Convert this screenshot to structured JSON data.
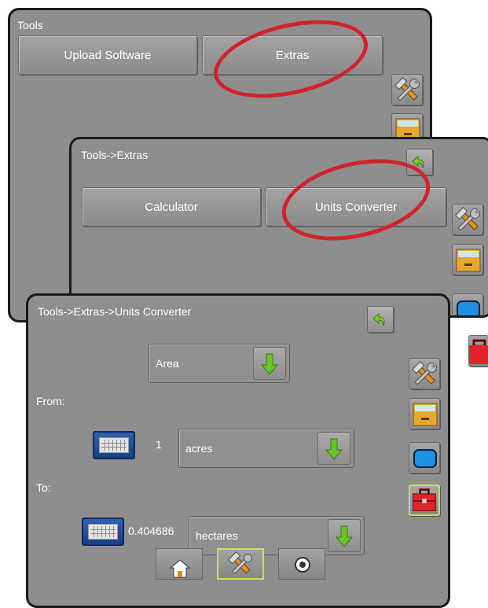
{
  "screen1": {
    "title": "Tools",
    "buttons": [
      "Upload Software",
      "Extras"
    ]
  },
  "screen2": {
    "title": "Tools->Extras",
    "buttons": [
      "Calculator",
      "Units Converter"
    ]
  },
  "screen3": {
    "title": "Tools->Extras->Units Converter",
    "category": "Area",
    "from_label": "From:",
    "from_value": "1",
    "from_unit": "acres",
    "to_label": "To:",
    "to_value": "0.404686",
    "to_unit": "hectares"
  },
  "side_nav": [
    "tools-icon",
    "file-cabinet-icon",
    "screen-icon",
    "toolbox-icon"
  ],
  "bottom_nav": [
    "home-icon",
    "tools-icon",
    "camera-icon"
  ],
  "colors": {
    "highlight_oval": "#d0232b",
    "active_border": "#c5e05a",
    "panel": "#8e8e8e"
  }
}
